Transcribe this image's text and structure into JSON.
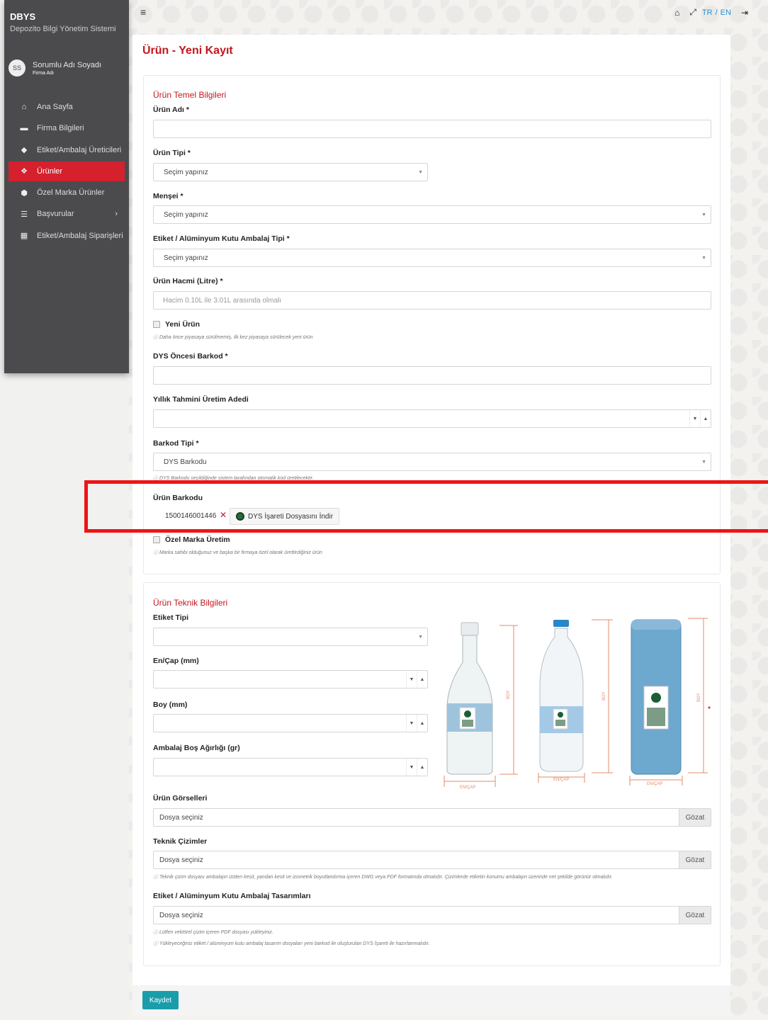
{
  "app": {
    "title": "DBYS",
    "subtitle": "Depozito Bilgi Yönetim Sistemi"
  },
  "user": {
    "initials": "SS",
    "name": "Sorumlu Adı Soyadı",
    "firm": "Firma Adı"
  },
  "sidebar": {
    "items": [
      {
        "label": "Ana Sayfa",
        "icon": "home-icon"
      },
      {
        "label": "Firma Bilgileri",
        "icon": "briefcase-icon"
      },
      {
        "label": "Etiket/Ambalaj Üreticileri",
        "icon": "tags-icon"
      },
      {
        "label": "Ürünler",
        "icon": "cubes-icon",
        "active": true
      },
      {
        "label": "Özel Marka Ürünler",
        "icon": "box-icon"
      },
      {
        "label": "Başvurular",
        "icon": "list-icon"
      },
      {
        "label": "Etiket/Ambalaj Siparişleri",
        "icon": "grid-icon"
      }
    ]
  },
  "topbar": {
    "lang_tr": "TR",
    "lang_sep": "/",
    "lang_en": "EN"
  },
  "page": {
    "title": "Ürün - Yeni Kayıt"
  },
  "basic": {
    "section_title": "Ürün Temel Bilgileri",
    "product_name_label": "Ürün Adı *",
    "product_type_label": "Ürün Tipi *",
    "product_type_value": "Seçim yapınız",
    "origin_label": "Menşei *",
    "origin_value": "Seçim yapınız",
    "package_type_label": "Etiket / Alüminyum Kutu Ambalaj Tipi *",
    "package_type_value": "Seçim yapınız",
    "volume_label": "Ürün Hacmi (Litre) *",
    "volume_placeholder": "Hacim 0.10L ile 3.01L arasında olmalı",
    "new_product_label": "Yeni Ürün",
    "new_product_help": "ⓘ Daha önce piyasaya sürülmemiş, ilk kez piyasaya sürülecek yeni ürün",
    "pre_barcode_label": "DYS Öncesi Barkod *",
    "annual_label": "Yıllık Tahmini Üretim Adedi",
    "barcode_type_label": "Barkod Tipi *",
    "barcode_type_value": "DYS Barkodu",
    "barcode_type_help": "ⓘ DYS Barkodu seçildiğinde sistem tarafından otomatik kod üretilecektir.",
    "product_barcode_label": "Ürün Barkodu",
    "product_barcode_value": "1500146001446",
    "download_label": "DYS İşareti Dosyasını İndir",
    "private_label_label": "Özel Marka Üretim",
    "private_label_help": "ⓘ Marka sahibi olduğunuz ve başka bir firmaya özel olarak ürettirdiğiniz ürün"
  },
  "technical": {
    "section_title": "Ürün Teknik Bilgileri",
    "label_type_label": "Etiket Tipi",
    "width_label": "En/Çap (mm)",
    "height_label": "Boy (mm)",
    "weight_label": "Ambalaj Boş Ağırlığı (gr)",
    "illustration": {
      "height_text": "BOY",
      "width_text": "EN/ÇAP"
    },
    "images_label": "Ürün Görselleri",
    "drawings_label": "Teknik Çizimler",
    "drawings_help": "ⓘ Teknik çizim dosyası ambalajın üstten kesit, yandan kesit ve izometrik boyutlandırma içeren DWG veya PDF formatında olmalıdır. Çizimlerde etiketin konumu ambalajın üzerinde net şekilde görünür olmalıdır.",
    "designs_label": "Etiket / Alüminyum Kutu Ambalaj Tasarımları",
    "designs_help1": "ⓘ Lütfen vektörel çizim içeren PDF dosyası yükleyiniz.",
    "designs_help2": "ⓘ Yükleyeceğiniz etiket / alüminyum kutu ambalaj tasarım dosyaları yeni barkod ile oluşturulan DYS İşareti ile hazırlanmalıdır.",
    "file_placeholder": "Dosya seçiniz",
    "browse_label": "Gözat"
  },
  "actions": {
    "save_label": "Kaydet"
  },
  "colors": {
    "accent": "#c4161c",
    "sidebar": "#4b4b4e",
    "save": "#1a9dab",
    "highlight": "#ee1515"
  }
}
